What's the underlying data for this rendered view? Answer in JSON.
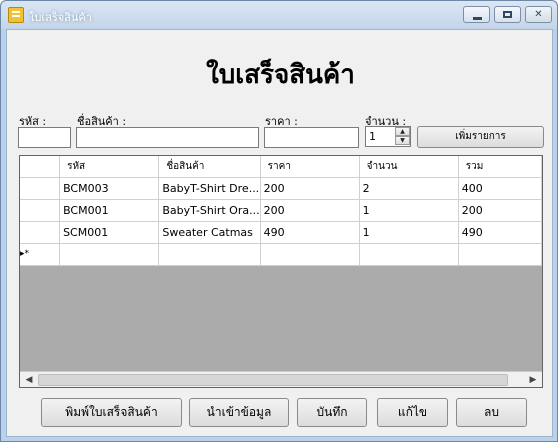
{
  "window": {
    "title": "ใบเสร็จสินค้า"
  },
  "heading": "ใบเสร็จสินค้า",
  "form": {
    "code_label": "รหัส :",
    "name_label": "ชื่อสินค้า :",
    "price_label": "ราคา :",
    "qty_label": "จำนวน :",
    "qty_value": "1",
    "add_button": "เพิ่มรายการ"
  },
  "grid": {
    "columns": [
      "รหัส",
      "ชื่อสินค้า",
      "ราคา",
      "จำนวน",
      "รวม"
    ],
    "rows": [
      [
        "BCM003",
        "BabyT-Shirt Dre...",
        "200",
        "2",
        "400"
      ],
      [
        "BCM001",
        "BabyT-Shirt Ora...",
        "200",
        "1",
        "200"
      ],
      [
        "SCM001",
        "Sweater Catmas",
        "490",
        "1",
        "490"
      ]
    ],
    "new_row_marker": "▸*"
  },
  "buttons": {
    "print": "พิมพ์ใบเสร็จสินค้า",
    "import": "นำเข้าข้อมูล",
    "save": "บันทึก",
    "edit": "แก้ไข",
    "delete": "ลบ"
  }
}
